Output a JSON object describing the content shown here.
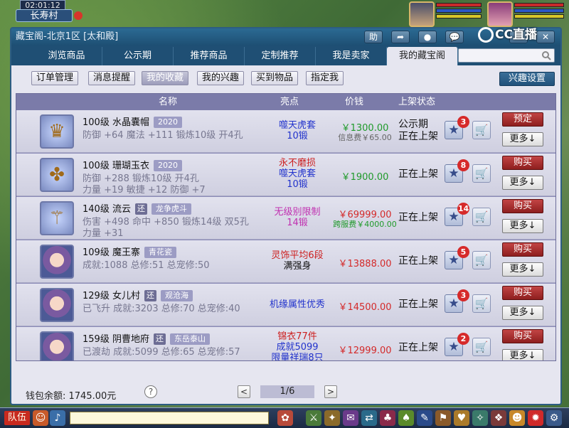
{
  "hud": {
    "clock": "02:01:12",
    "town": "长寿村"
  },
  "window": {
    "title": "藏宝阁-北京1区 [太和殿]",
    "title_buttons": [
      "助",
      "➦",
      "●",
      "💬",
      "–",
      "✕"
    ]
  },
  "tabs": [
    {
      "label": "浏览商品"
    },
    {
      "label": "公示期"
    },
    {
      "label": "推荐商品"
    },
    {
      "label": "定制推荐"
    },
    {
      "label": "我是卖家"
    },
    {
      "label": "我的藏宝阁"
    }
  ],
  "search": {
    "placeholder": ""
  },
  "subnav": [
    {
      "label": "订单管理"
    },
    {
      "label": "消息提醒"
    },
    {
      "label": "我的收藏"
    },
    {
      "label": "我的兴趣"
    },
    {
      "label": "买到物品"
    },
    {
      "label": "指定我"
    }
  ],
  "interest_button": "兴趣设置",
  "columns": {
    "name": "名称",
    "highlight": "亮点",
    "price": "价钱",
    "status": "上架状态"
  },
  "rows": [
    {
      "name": "100级 水晶囊帽",
      "tag": "2020",
      "huan": "",
      "attr1": "防御 +64 魔法 +111 锻炼10级 开4孔",
      "attr2": "",
      "highlight": [
        "噬天虎套",
        "10锻"
      ],
      "highlight_colors": [
        "#2233cc",
        "#2233cc"
      ],
      "price": "￥1300.00",
      "fee": "信息费￥65.00",
      "price_green": true,
      "status": [
        "公示期",
        "正在上架"
      ],
      "fav_count": "3",
      "action": "预定",
      "more": "更多↓"
    },
    {
      "name": "100级 珊瑚玉衣",
      "tag": "2020",
      "huan": "",
      "attr1": "防御 +288 锻炼10级 开4孔",
      "attr2": "力量 +19 敏捷 +12 防御 +7",
      "highlight": [
        "永不磨损",
        "噬天虎套",
        "10锻"
      ],
      "highlight_colors": [
        "#cc1f1f",
        "#2233cc",
        "#2233cc"
      ],
      "price": "￥1900.00",
      "fee": "",
      "price_green": true,
      "status": [
        "正在上架"
      ],
      "fav_count": "8",
      "action": "购买",
      "more": "更多↓"
    },
    {
      "name": "140级 流云",
      "tag": "龙争虎斗",
      "huan": "还",
      "attr1": "伤害 +498 命中 +850 锻炼14级 双5孔",
      "attr2": "力量 +31",
      "highlight": [
        "无级别限制",
        "14锻"
      ],
      "highlight_colors": [
        "#c030b0",
        "#c030b0"
      ],
      "price": "￥69999.00",
      "fee": "跨服费￥4000.00",
      "price_green": false,
      "status": [
        "正在上架"
      ],
      "fav_count": "14",
      "action": "购买",
      "more": "更多↓"
    },
    {
      "name": "109级 魔王寨",
      "tag": "青花瓷",
      "huan": "",
      "attr1": "成就:1088 总修:51 总宠修:50",
      "attr2": "",
      "highlight": [
        "灵饰平均6段",
        "满强身"
      ],
      "highlight_colors": [
        "#cc1f1f",
        "#111111"
      ],
      "price": "￥13888.00",
      "fee": "",
      "price_green": false,
      "status": [
        "正在上架"
      ],
      "fav_count": "5",
      "action": "购买",
      "more": "更多↓"
    },
    {
      "name": "129级 女儿村",
      "tag": "观沧海",
      "huan": "还",
      "attr1": "已飞升 成就:3203 总修:70 总宠修:40",
      "attr2": "",
      "highlight": [
        "机缘属性优秀"
      ],
      "highlight_colors": [
        "#2233cc"
      ],
      "price": "￥14500.00",
      "fee": "",
      "price_green": false,
      "status": [
        "正在上架"
      ],
      "fav_count": "3",
      "action": "购买",
      "more": "更多↓"
    },
    {
      "name": "159级 阴曹地府",
      "tag": "东岳泰山",
      "huan": "还",
      "attr1": "已渡劫 成就:5099 总修:65 总宠修:57",
      "attr2": "",
      "highlight": [
        "锦衣77件",
        "成就5099",
        "限量祥瑞8只"
      ],
      "highlight_colors": [
        "#cc1f1f",
        "#2233cc",
        "#2233cc"
      ],
      "price": "￥12999.00",
      "fee": "",
      "price_green": false,
      "status": [
        "正在上架"
      ],
      "fav_count": "2",
      "action": "购买",
      "more": "更多↓"
    }
  ],
  "footer": {
    "wallet": "钱包余额: 1745.00元",
    "help": "?",
    "prev": "<",
    "page": "1/6",
    "next": ">"
  },
  "gamebar": {
    "team": "队伍"
  },
  "stream_logo": "CC直播"
}
